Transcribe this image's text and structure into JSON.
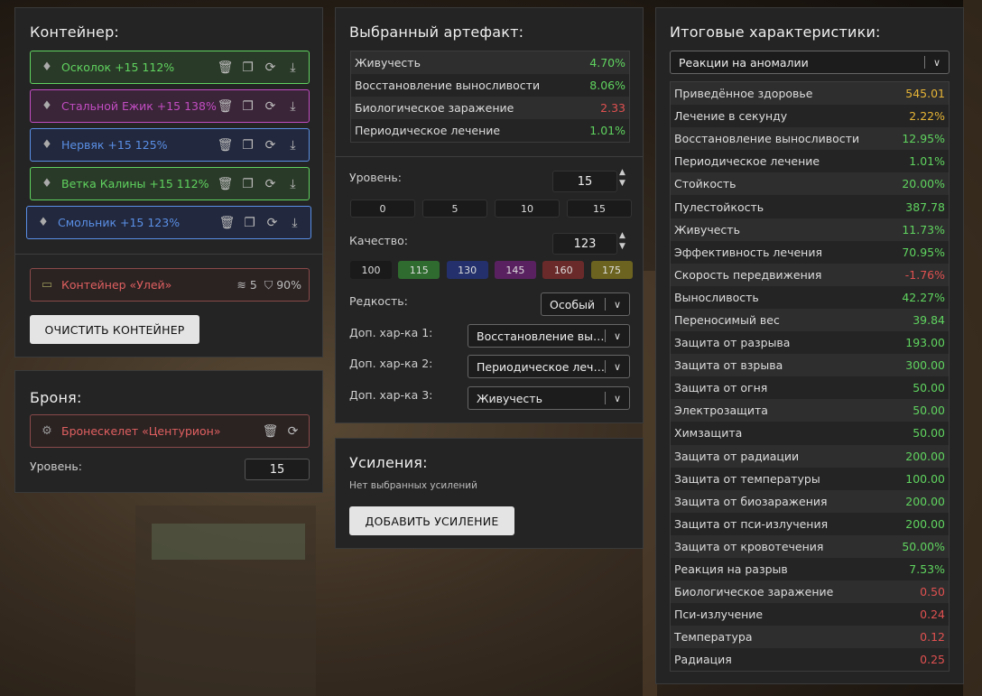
{
  "container": {
    "title": "Контейнер:",
    "items": [
      {
        "name": "Осколок +15 112%",
        "icon": "artifact-shard-icon",
        "color": "#5fd35f"
      },
      {
        "name": "Стальной Ежик +15 138%",
        "icon": "artifact-hedgehog-icon",
        "color": "#c24dc2"
      },
      {
        "name": "Нервяк +15 125%",
        "icon": "artifact-nervyak-icon",
        "color": "#5a8fe6"
      },
      {
        "name": "Ветка Калины +15 112%",
        "icon": "artifact-viburnum-icon",
        "color": "#5fd35f"
      },
      {
        "name": "Смольник +15 123%",
        "icon": "artifact-smolnik-icon",
        "color": "#5a8fe6"
      }
    ],
    "box": {
      "name": "Контейнер «Улей»",
      "slots": "5",
      "protection": "90%"
    },
    "clear_button": "ОЧИСТИТЬ КОНТЕЙНЕР"
  },
  "armor": {
    "title": "Броня:",
    "item": "Бронескелет «Центурион»",
    "level_label": "Уровень:",
    "level_value": "15"
  },
  "artifact": {
    "title": "Выбранный артефакт:",
    "stats": [
      {
        "name": "Живучесть",
        "value": "4.70%",
        "color": "green"
      },
      {
        "name": "Восстановление выносливости",
        "value": "8.06%",
        "color": "green"
      },
      {
        "name": "Биологическое заражение",
        "value": "2.33",
        "color": "red"
      },
      {
        "name": "Периодическое лечение",
        "value": "1.01%",
        "color": "green"
      }
    ],
    "level_label": "Уровень:",
    "level_value": "15",
    "level_presets": [
      "0",
      "5",
      "10",
      "15"
    ],
    "quality_label": "Качество:",
    "quality_value": "123",
    "quality_presets": [
      {
        "label": "100",
        "bg": "#1a1a1a"
      },
      {
        "label": "115",
        "bg": "#2f6b2f"
      },
      {
        "label": "130",
        "bg": "#23306b"
      },
      {
        "label": "145",
        "bg": "#5a2161"
      },
      {
        "label": "160",
        "bg": "#6b2a2a"
      },
      {
        "label": "175",
        "bg": "#6b631f"
      }
    ],
    "rarity_label": "Редкость:",
    "rarity_value": "Особый",
    "extra1_label": "Доп. хар-ка 1:",
    "extra1_value": "Восстановление выносливости",
    "extra2_label": "Доп. хар-ка 2:",
    "extra2_value": "Периодическое лечение",
    "extra3_label": "Доп. хар-ка 3:",
    "extra3_value": "Живучесть"
  },
  "boosts": {
    "title": "Усиления:",
    "empty_text": "Нет выбранных усилений",
    "add_button": "ДОБАВИТЬ УСИЛЕНИЕ"
  },
  "totals": {
    "title": "Итоговые характеристики:",
    "filter_value": "Реакции на аномалии",
    "stats": [
      {
        "name": "Приведённое здоровье",
        "value": "545.01",
        "color": "yellow"
      },
      {
        "name": "Лечение в секунду",
        "value": "2.22%",
        "color": "yellow"
      },
      {
        "name": "Восстановление выносливости",
        "value": "12.95%",
        "color": "green"
      },
      {
        "name": "Периодическое лечение",
        "value": "1.01%",
        "color": "green"
      },
      {
        "name": "Стойкость",
        "value": "20.00%",
        "color": "green"
      },
      {
        "name": "Пулестойкость",
        "value": "387.78",
        "color": "green"
      },
      {
        "name": "Живучесть",
        "value": "11.73%",
        "color": "green"
      },
      {
        "name": "Эффективность лечения",
        "value": "70.95%",
        "color": "green"
      },
      {
        "name": "Скорость передвижения",
        "value": "-1.76%",
        "color": "red"
      },
      {
        "name": "Выносливость",
        "value": "42.27%",
        "color": "green"
      },
      {
        "name": "Переносимый вес",
        "value": "39.84",
        "color": "green"
      },
      {
        "name": "Защита от разрыва",
        "value": "193.00",
        "color": "green"
      },
      {
        "name": "Защита от взрыва",
        "value": "300.00",
        "color": "green"
      },
      {
        "name": "Защита от огня",
        "value": "50.00",
        "color": "green"
      },
      {
        "name": "Электрозащита",
        "value": "50.00",
        "color": "green"
      },
      {
        "name": "Химзащита",
        "value": "50.00",
        "color": "green"
      },
      {
        "name": "Защита от радиации",
        "value": "200.00",
        "color": "green"
      },
      {
        "name": "Защита от температуры",
        "value": "100.00",
        "color": "green"
      },
      {
        "name": "Защита от биозаражения",
        "value": "200.00",
        "color": "green"
      },
      {
        "name": "Защита от пси-излучения",
        "value": "200.00",
        "color": "green"
      },
      {
        "name": "Защита от кровотечения",
        "value": "50.00%",
        "color": "green"
      },
      {
        "name": "Реакция на разрыв",
        "value": "7.53%",
        "color": "green"
      },
      {
        "name": "Биологическое заражение",
        "value": "0.50",
        "color": "red"
      },
      {
        "name": "Пси-излучение",
        "value": "0.24",
        "color": "red"
      },
      {
        "name": "Температура",
        "value": "0.12",
        "color": "red"
      },
      {
        "name": "Радиация",
        "value": "0.25",
        "color": "red"
      }
    ]
  }
}
